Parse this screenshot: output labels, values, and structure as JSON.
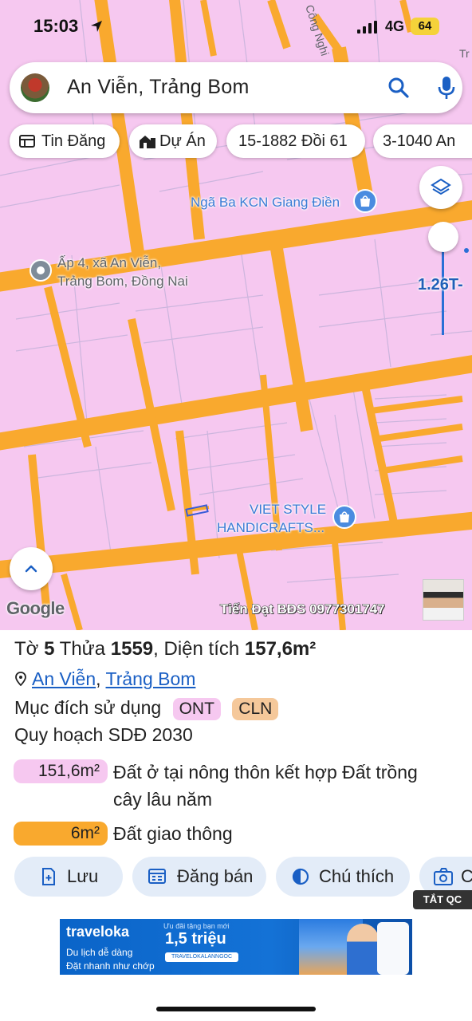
{
  "status_bar": {
    "time": "15:03",
    "network": "4G",
    "battery": "64"
  },
  "search": {
    "query": "An Viễn, Trảng Bom"
  },
  "chips": [
    {
      "label": "Tin Đăng",
      "icon": "listing-icon"
    },
    {
      "label": "Dự Án",
      "icon": "project-icon"
    },
    {
      "label": "15-1882 Đồi 61"
    },
    {
      "label": "3-1040 An"
    }
  ],
  "map": {
    "road_label_top": "Công Nghi",
    "corner_text": "Tr",
    "poi_kcn": "Ngã Ba KCN Giang Điền",
    "pin_line1": "Ấp 4, xã An Viễn,",
    "pin_line2": "Trảng Bom, Đồng Nai",
    "viet_style_line1": "VIET STYLE",
    "viet_style_line2": "HANDICRAFTS...",
    "scale_label": "1.26T-",
    "google": "Google",
    "watermark": "Tiến Đạt BĐS 0977301747"
  },
  "parcel": {
    "sheet_label": "Tờ",
    "sheet_no": "5",
    "plot_label": "Thửa",
    "plot_no": "1559",
    "area_label": ", Diện tích",
    "area": "157,6m²",
    "commune": "An Viễn",
    "district": "Trảng Bom",
    "purpose_label": "Mục đích sử dụng",
    "purpose_tags": [
      "ONT",
      "CLN"
    ],
    "plan_label": "Quy hoạch SDĐ 2030",
    "plan_items": [
      {
        "area": "151,6m²",
        "desc_line1": "Đất ở tại nông thôn kết hợp Đất trồng",
        "desc_line2": "cây lâu năm",
        "color": "#f6c8f0"
      },
      {
        "area": "6m²",
        "desc_line1": "Đất giao thông",
        "color": "#f9a92e"
      }
    ]
  },
  "actions": [
    {
      "label": "Lưu",
      "icon": "save-icon"
    },
    {
      "label": "Đăng bán",
      "icon": "calendar-icon"
    },
    {
      "label": "Chú thích",
      "icon": "legend-icon"
    },
    {
      "label": "C",
      "icon": "camera-icon"
    }
  ],
  "ad": {
    "badge": "TẮT QC",
    "brand": "traveloka",
    "line1": "Du lịch dễ dàng",
    "line2": "Đặt nhanh như chớp",
    "promo": "Ưu đãi tặng bạn mới",
    "price": "1,5 triệu",
    "code": "TRAVELOKALANNGOC"
  },
  "colors": {
    "parcel_pink": "#f6c8f0",
    "road_orange": "#f9a92e",
    "link_blue": "#1a5fc4",
    "action_bg": "#e3ecf8"
  }
}
